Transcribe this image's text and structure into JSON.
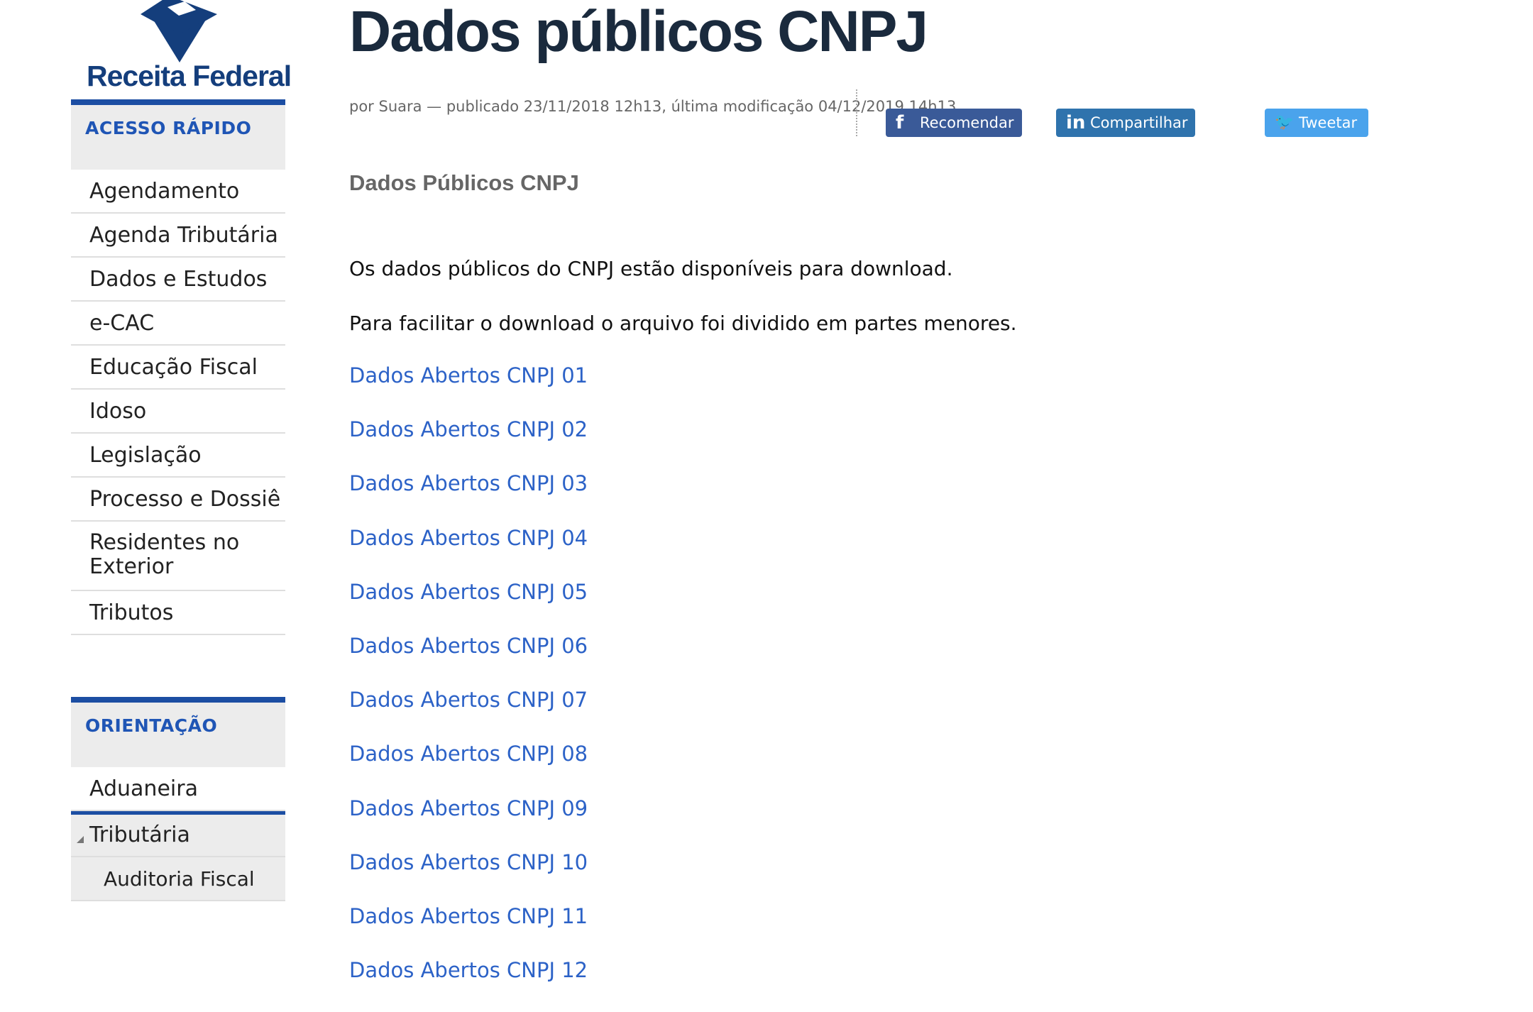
{
  "brand": {
    "logo_text": "Receita Federal"
  },
  "sidebar": {
    "quick_access": {
      "title": "ACESSO RÁPIDO",
      "items": [
        {
          "label": "Agendamento"
        },
        {
          "label": "Agenda Tributária"
        },
        {
          "label": "Dados e Estudos"
        },
        {
          "label": "e-CAC"
        },
        {
          "label": "Educação Fiscal"
        },
        {
          "label": "Idoso"
        },
        {
          "label": "Legislação"
        },
        {
          "label": "Processo e Dossiê"
        },
        {
          "label": "Residentes no Exterior"
        },
        {
          "label": "Tributos"
        }
      ]
    },
    "orientation": {
      "title": "ORIENTAÇÃO",
      "items": [
        {
          "label": "Aduaneira"
        },
        {
          "label": "Tributária"
        },
        {
          "label": "Auditoria Fiscal"
        }
      ]
    }
  },
  "main": {
    "title": "Dados públicos CNPJ",
    "byline": "por Suara — publicado 23/11/2018 12h13, última modificação 04/12/2019 14h13",
    "social": {
      "facebook": "Recomendar",
      "linkedin": "Compartilhar",
      "twitter": "Tweetar"
    },
    "subheading": "Dados Públicos CNPJ",
    "paragraphs": [
      "Os dados públicos do CNPJ estão disponíveis para download.",
      "Para facilitar o download o arquivo foi dividido em partes menores."
    ],
    "links": [
      "Dados Abertos CNPJ 01",
      "Dados Abertos CNPJ 02",
      "Dados Abertos CNPJ 03",
      "Dados Abertos CNPJ 04",
      "Dados Abertos CNPJ 05",
      "Dados Abertos CNPJ 06",
      "Dados Abertos CNPJ 07",
      "Dados Abertos CNPJ 08",
      "Dados Abertos CNPJ 09",
      "Dados Abertos CNPJ 10",
      "Dados Abertos CNPJ 11",
      "Dados Abertos CNPJ 12"
    ]
  },
  "colors": {
    "accent": "#1c4ea3",
    "link": "#2c62c7",
    "facebook": "#3a5a98",
    "linkedin": "#2f73ad",
    "twitter": "#4aa3ec"
  }
}
